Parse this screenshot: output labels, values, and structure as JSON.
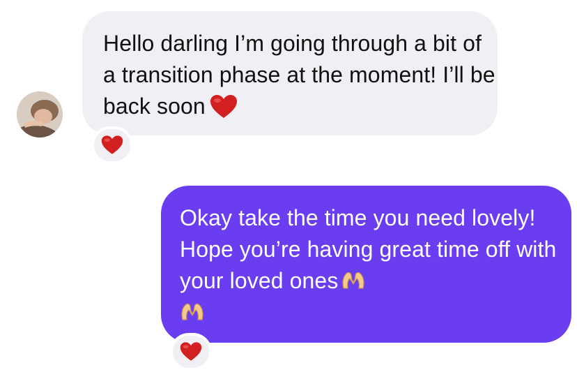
{
  "conversation": {
    "incoming": {
      "text": "Hello darling I’m going through a bit of a transition phase at the moment! I’ll be back soon",
      "trailing_emoji": "heart-emoji",
      "reaction": "heart-emoji",
      "bubble_color": "#efeff4",
      "text_color": "#111111",
      "avatar": "contact-avatar"
    },
    "outgoing": {
      "text": "Okay take the time you need lovely! Hope you’re having great time off with your loved ones",
      "trailing_emojis": [
        "heart-hands-emoji",
        "heart-hands-emoji"
      ],
      "reaction": "heart-emoji",
      "bubble_color": "#6a3ef0",
      "text_color": "#ffffff"
    }
  }
}
